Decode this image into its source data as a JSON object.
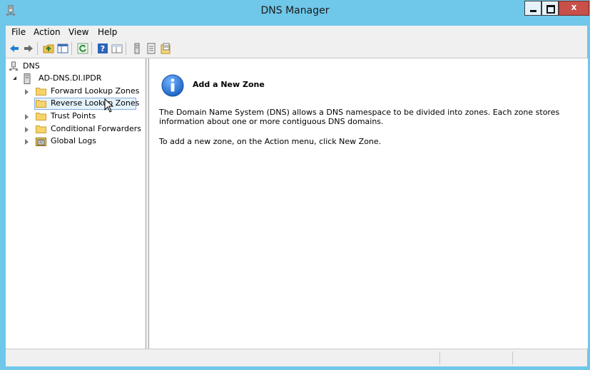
{
  "window": {
    "title": "DNS Manager",
    "close_label": "x"
  },
  "menu": [
    "File",
    "Action",
    "View",
    "Help"
  ],
  "toolbar_icons": [
    "back-arrow-icon",
    "forward-arrow-icon",
    "up-folder-icon",
    "show-hide-tree-icon",
    "refresh-icon",
    "help-icon",
    "properties-icon",
    "server-icon",
    "zone-list-icon",
    "export-list-icon"
  ],
  "tree": {
    "root": "DNS",
    "server": "AD-DNS.DI.IPDR",
    "items": [
      {
        "label": "Forward Lookup Zones"
      },
      {
        "label": "Reverse Lookup Zones",
        "selected": true
      },
      {
        "label": "Trust Points"
      },
      {
        "label": "Conditional Forwarders"
      },
      {
        "label": "Global Logs"
      }
    ]
  },
  "content": {
    "heading": "Add a New Zone",
    "para1_line1": "The Domain Name System (DNS) allows a DNS namespace to be divided into zones. Each zone stores",
    "para1_line2": "information about one or more contiguous DNS domains.",
    "para2": "To add a new zone, on the Action menu, click New Zone."
  },
  "colors": {
    "titlebar": "#6fc7e9",
    "close": "#c7504a",
    "selection": "#e5f3fb",
    "info": "#1f64c4"
  }
}
